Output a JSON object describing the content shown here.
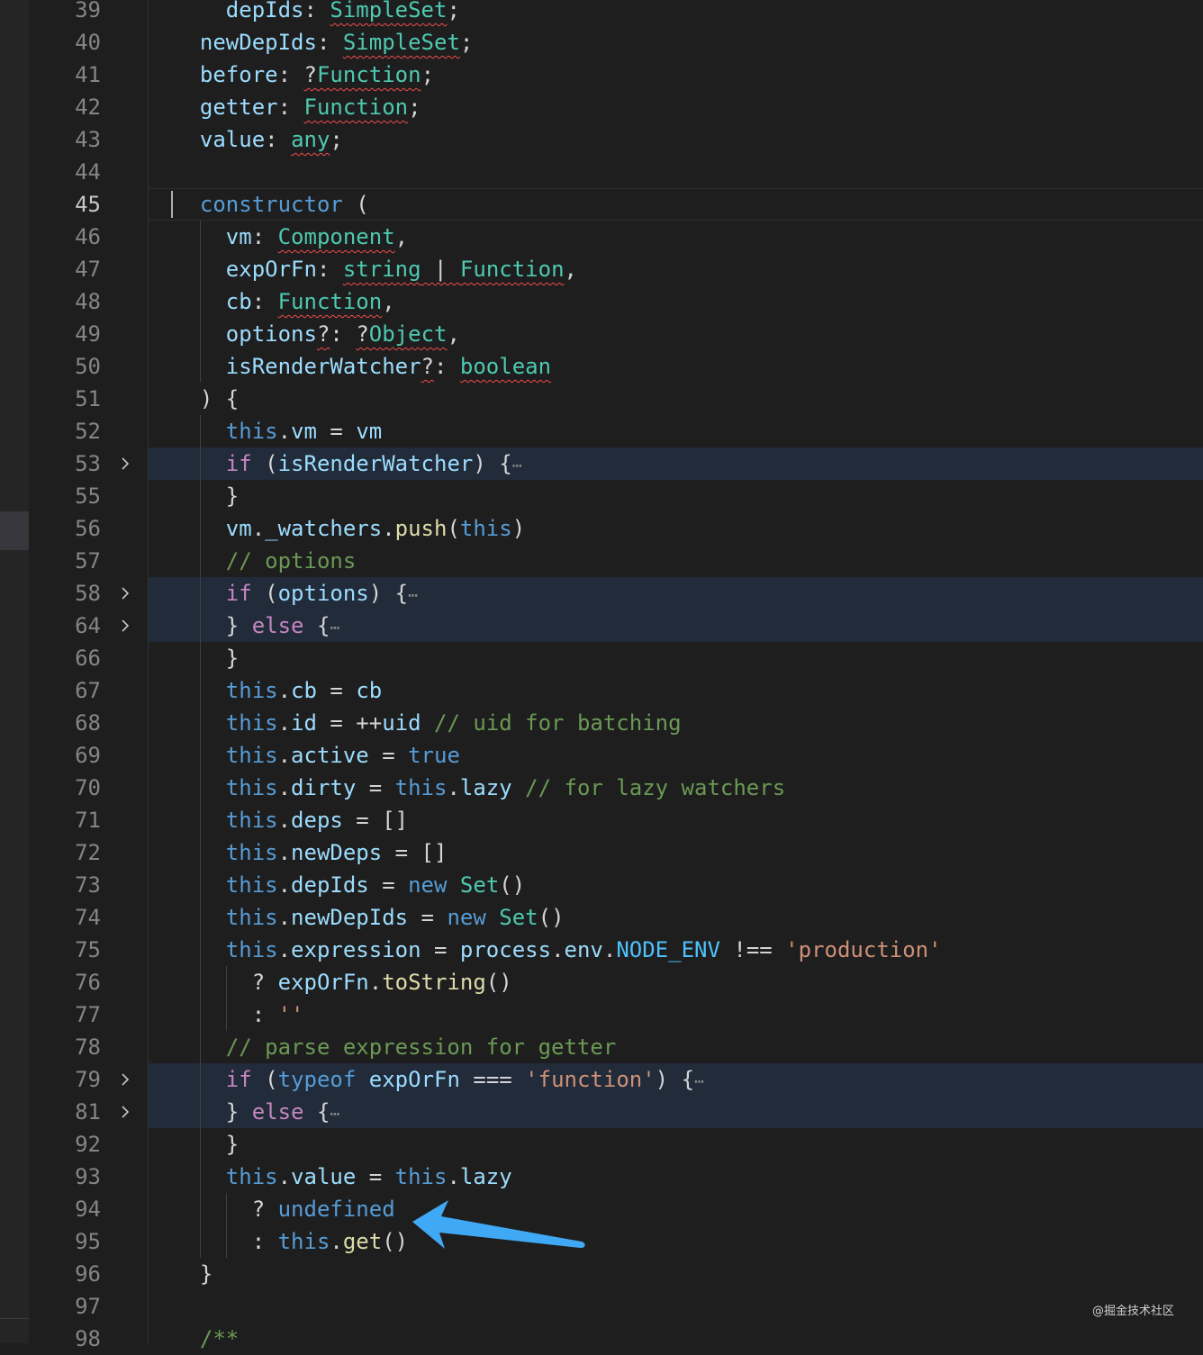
{
  "watermark": "@掘金技术社区",
  "code_lines": [
    {
      "ln": "39",
      "segs": [
        [
          "",
          "    "
        ],
        [
          "var",
          "depIds"
        ],
        [
          "",
          ": "
        ],
        [
          "type sq",
          "SimpleSet"
        ],
        [
          "",
          ";"
        ]
      ]
    },
    {
      "ln": "40",
      "segs": [
        [
          "",
          "  "
        ],
        [
          "var",
          "newDepIds"
        ],
        [
          "",
          ": "
        ],
        [
          "type sq",
          "SimpleSet"
        ],
        [
          "",
          ";"
        ]
      ]
    },
    {
      "ln": "41",
      "segs": [
        [
          "",
          "  "
        ],
        [
          "var",
          "before"
        ],
        [
          "",
          ": "
        ],
        [
          "sq",
          "?"
        ],
        [
          "type sq",
          "Function"
        ],
        [
          "",
          ";"
        ]
      ]
    },
    {
      "ln": "42",
      "segs": [
        [
          "",
          "  "
        ],
        [
          "var",
          "getter"
        ],
        [
          "",
          ": "
        ],
        [
          "type sq",
          "Function"
        ],
        [
          "",
          ";"
        ]
      ]
    },
    {
      "ln": "43",
      "segs": [
        [
          "",
          "  "
        ],
        [
          "var",
          "value"
        ],
        [
          "",
          ": "
        ],
        [
          "type sq",
          "any"
        ],
        [
          "",
          ";"
        ]
      ]
    },
    {
      "ln": "44",
      "segs": []
    },
    {
      "ln": "45",
      "segs": [
        [
          "",
          "  "
        ],
        [
          "kw",
          "constructor"
        ],
        [
          "",
          " ("
        ]
      ]
    },
    {
      "ln": "46",
      "segs": [
        [
          "",
          "    "
        ],
        [
          "var",
          "vm"
        ],
        [
          "",
          ": "
        ],
        [
          "type sq",
          "Component"
        ],
        [
          "",
          ","
        ]
      ]
    },
    {
      "ln": "47",
      "segs": [
        [
          "",
          "    "
        ],
        [
          "var",
          "expOrFn"
        ],
        [
          "",
          ": "
        ],
        [
          "type sq",
          "string"
        ],
        [
          "sq",
          " | "
        ],
        [
          "type sq",
          "Function"
        ],
        [
          "",
          ","
        ]
      ]
    },
    {
      "ln": "48",
      "segs": [
        [
          "",
          "    "
        ],
        [
          "var",
          "cb"
        ],
        [
          "",
          ": "
        ],
        [
          "type sq",
          "Function"
        ],
        [
          "",
          ","
        ]
      ]
    },
    {
      "ln": "49",
      "segs": [
        [
          "",
          "    "
        ],
        [
          "var",
          "options"
        ],
        [
          "sq",
          "?"
        ],
        [
          "",
          ": "
        ],
        [
          "sq",
          "?"
        ],
        [
          "type sq",
          "Object"
        ],
        [
          "",
          ","
        ]
      ]
    },
    {
      "ln": "50",
      "segs": [
        [
          "",
          "    "
        ],
        [
          "var",
          "isRenderWatcher"
        ],
        [
          "sq",
          "?"
        ],
        [
          "",
          ": "
        ],
        [
          "type sq",
          "boolean"
        ]
      ]
    },
    {
      "ln": "51",
      "segs": [
        [
          "",
          "  ) {"
        ]
      ]
    },
    {
      "ln": "52",
      "segs": [
        [
          "",
          "    "
        ],
        [
          "kw",
          "this"
        ],
        [
          "",
          "."
        ],
        [
          "var",
          "vm"
        ],
        [
          "",
          " = "
        ],
        [
          "var",
          "vm"
        ]
      ]
    },
    {
      "ln": "53",
      "segs": [
        [
          "",
          "    "
        ],
        [
          "ctl",
          "if"
        ],
        [
          "",
          " ("
        ],
        [
          "var",
          "isRenderWatcher"
        ],
        [
          "",
          ") {"
        ],
        [
          "ell",
          "⋯"
        ]
      ]
    },
    {
      "ln": "55",
      "segs": [
        [
          "",
          "    }"
        ]
      ]
    },
    {
      "ln": "56",
      "segs": [
        [
          "",
          "    "
        ],
        [
          "var",
          "vm"
        ],
        [
          "",
          "."
        ],
        [
          "var",
          "_watchers"
        ],
        [
          "",
          "."
        ],
        [
          "fn",
          "push"
        ],
        [
          "",
          "("
        ],
        [
          "kw",
          "this"
        ],
        [
          "",
          ")"
        ]
      ]
    },
    {
      "ln": "57",
      "segs": [
        [
          "",
          "    "
        ],
        [
          "cmt",
          "// options"
        ]
      ]
    },
    {
      "ln": "58",
      "segs": [
        [
          "",
          "    "
        ],
        [
          "ctl",
          "if"
        ],
        [
          "",
          " ("
        ],
        [
          "var",
          "options"
        ],
        [
          "",
          ") {"
        ],
        [
          "ell",
          "⋯"
        ]
      ]
    },
    {
      "ln": "64",
      "segs": [
        [
          "",
          "    } "
        ],
        [
          "ctl",
          "else"
        ],
        [
          "",
          " {"
        ],
        [
          "ell",
          "⋯"
        ]
      ]
    },
    {
      "ln": "66",
      "segs": [
        [
          "",
          "    }"
        ]
      ]
    },
    {
      "ln": "67",
      "segs": [
        [
          "",
          "    "
        ],
        [
          "kw",
          "this"
        ],
        [
          "",
          "."
        ],
        [
          "var",
          "cb"
        ],
        [
          "",
          " = "
        ],
        [
          "var",
          "cb"
        ]
      ]
    },
    {
      "ln": "68",
      "segs": [
        [
          "",
          "    "
        ],
        [
          "kw",
          "this"
        ],
        [
          "",
          "."
        ],
        [
          "var",
          "id"
        ],
        [
          "",
          " = ++"
        ],
        [
          "var",
          "uid"
        ],
        [
          "",
          " "
        ],
        [
          "cmt",
          "// uid for batching"
        ]
      ]
    },
    {
      "ln": "69",
      "segs": [
        [
          "",
          "    "
        ],
        [
          "kw",
          "this"
        ],
        [
          "",
          "."
        ],
        [
          "var",
          "active"
        ],
        [
          "",
          " = "
        ],
        [
          "kw",
          "true"
        ]
      ]
    },
    {
      "ln": "70",
      "segs": [
        [
          "",
          "    "
        ],
        [
          "kw",
          "this"
        ],
        [
          "",
          "."
        ],
        [
          "var",
          "dirty"
        ],
        [
          "",
          " = "
        ],
        [
          "kw",
          "this"
        ],
        [
          "",
          "."
        ],
        [
          "var",
          "lazy"
        ],
        [
          "",
          " "
        ],
        [
          "cmt",
          "// for lazy watchers"
        ]
      ]
    },
    {
      "ln": "71",
      "segs": [
        [
          "",
          "    "
        ],
        [
          "kw",
          "this"
        ],
        [
          "",
          "."
        ],
        [
          "var",
          "deps"
        ],
        [
          "",
          " = []"
        ]
      ]
    },
    {
      "ln": "72",
      "segs": [
        [
          "",
          "    "
        ],
        [
          "kw",
          "this"
        ],
        [
          "",
          "."
        ],
        [
          "var",
          "newDeps"
        ],
        [
          "",
          " = []"
        ]
      ]
    },
    {
      "ln": "73",
      "segs": [
        [
          "",
          "    "
        ],
        [
          "kw",
          "this"
        ],
        [
          "",
          "."
        ],
        [
          "var",
          "depIds"
        ],
        [
          "",
          " = "
        ],
        [
          "kw",
          "new"
        ],
        [
          "",
          " "
        ],
        [
          "type",
          "Set"
        ],
        [
          "",
          "()"
        ]
      ]
    },
    {
      "ln": "74",
      "segs": [
        [
          "",
          "    "
        ],
        [
          "kw",
          "this"
        ],
        [
          "",
          "."
        ],
        [
          "var",
          "newDepIds"
        ],
        [
          "",
          " = "
        ],
        [
          "kw",
          "new"
        ],
        [
          "",
          " "
        ],
        [
          "type",
          "Set"
        ],
        [
          "",
          "()"
        ]
      ]
    },
    {
      "ln": "75",
      "segs": [
        [
          "",
          "    "
        ],
        [
          "kw",
          "this"
        ],
        [
          "",
          "."
        ],
        [
          "var",
          "expression"
        ],
        [
          "",
          " = "
        ],
        [
          "var",
          "process"
        ],
        [
          "",
          "."
        ],
        [
          "var",
          "env"
        ],
        [
          "",
          "."
        ],
        [
          "const",
          "NODE_ENV"
        ],
        [
          "",
          " !== "
        ],
        [
          "str",
          "'production'"
        ]
      ]
    },
    {
      "ln": "76",
      "segs": [
        [
          "",
          "      ? "
        ],
        [
          "var",
          "expOrFn"
        ],
        [
          "",
          "."
        ],
        [
          "fn",
          "toString"
        ],
        [
          "",
          "()"
        ]
      ]
    },
    {
      "ln": "77",
      "segs": [
        [
          "",
          "      : "
        ],
        [
          "str",
          "''"
        ]
      ]
    },
    {
      "ln": "78",
      "segs": [
        [
          "",
          "    "
        ],
        [
          "cmt",
          "// parse expression for getter"
        ]
      ]
    },
    {
      "ln": "79",
      "segs": [
        [
          "",
          "    "
        ],
        [
          "ctl",
          "if"
        ],
        [
          "",
          " ("
        ],
        [
          "kw",
          "typeof"
        ],
        [
          "",
          " "
        ],
        [
          "var",
          "expOrFn"
        ],
        [
          "",
          " === "
        ],
        [
          "str",
          "'function'"
        ],
        [
          "",
          ") {"
        ],
        [
          "ell",
          "⋯"
        ]
      ]
    },
    {
      "ln": "81",
      "segs": [
        [
          "",
          "    } "
        ],
        [
          "ctl",
          "else"
        ],
        [
          "",
          " {"
        ],
        [
          "ell",
          "⋯"
        ]
      ]
    },
    {
      "ln": "92",
      "segs": [
        [
          "",
          "    }"
        ]
      ]
    },
    {
      "ln": "93",
      "segs": [
        [
          "",
          "    "
        ],
        [
          "kw",
          "this"
        ],
        [
          "",
          "."
        ],
        [
          "var",
          "value"
        ],
        [
          "",
          " = "
        ],
        [
          "kw",
          "this"
        ],
        [
          "",
          "."
        ],
        [
          "var",
          "lazy"
        ]
      ]
    },
    {
      "ln": "94",
      "segs": [
        [
          "",
          "      ? "
        ],
        [
          "kw",
          "undefined"
        ]
      ]
    },
    {
      "ln": "95",
      "segs": [
        [
          "",
          "      : "
        ],
        [
          "kw",
          "this"
        ],
        [
          "",
          "."
        ],
        [
          "fn",
          "get"
        ],
        [
          "",
          "()"
        ]
      ]
    },
    {
      "ln": "96",
      "segs": [
        [
          "",
          "  }"
        ]
      ]
    },
    {
      "ln": "97",
      "segs": []
    },
    {
      "ln": "98",
      "segs": [
        [
          "",
          "  "
        ],
        [
          "cmt",
          "/**"
        ]
      ]
    }
  ]
}
